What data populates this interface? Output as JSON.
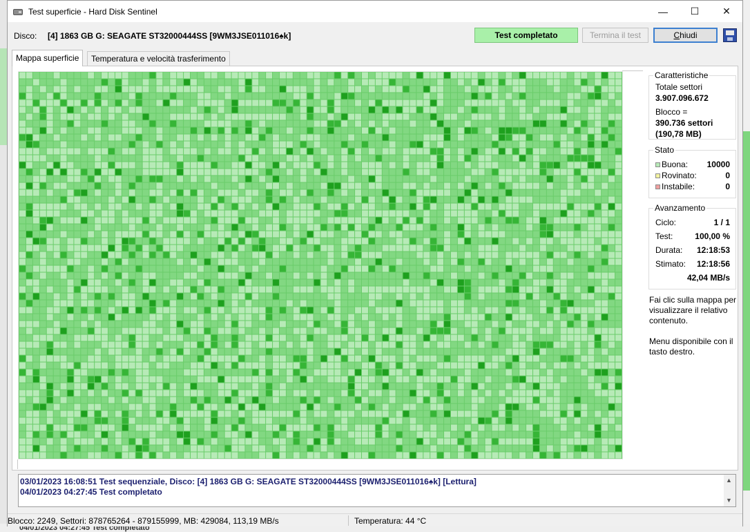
{
  "window": {
    "title": "Test superficie - Hard Disk Sentinel",
    "controls": {
      "minimize": "—",
      "maximize": "☐",
      "close": "✕"
    }
  },
  "header": {
    "disk_label": "Disco:",
    "disk_value": "[4] 1863 GB G: SEAGATE ST32000444SS [9WM3JSE011016♠k]",
    "status_button": "Test completato",
    "stop_button": "Termina il test",
    "close_button_first": "C",
    "close_button_rest": "hiudi"
  },
  "tabs": [
    {
      "label": "Mappa superficie",
      "active": true
    },
    {
      "label": "Temperatura e velocità trasferimento",
      "active": false
    }
  ],
  "surface_map": {
    "cols": 88,
    "rows": 56,
    "block_count": 10000,
    "colors": {
      "grid": "#6acc6a",
      "normal": "#82d882",
      "light": "#b7eab7",
      "dark": "#36b536",
      "deep": "#1ea01e"
    }
  },
  "characteristics": {
    "title": "Caratteristiche",
    "total_label": "Totale settori",
    "total_value": "3.907.096.672",
    "block_label": "Blocco =",
    "block_sectors": "390.736 settori",
    "block_mb": "(190,78 MB)"
  },
  "state": {
    "title": "Stato",
    "rows": [
      {
        "label": "Buona:",
        "value": "10000",
        "color": "#b7eab7"
      },
      {
        "label": "Rovinato:",
        "value": "0",
        "color": "#f3f3a0"
      },
      {
        "label": "Instabile:",
        "value": "0",
        "color": "#f0a0a0"
      }
    ]
  },
  "progress": {
    "title": "Avanzamento",
    "rows": [
      {
        "label": "Ciclo:",
        "value": "1 / 1"
      },
      {
        "label": "Test:",
        "value": "100,00 %"
      },
      {
        "label": "Durata:",
        "value": "12:18:53"
      },
      {
        "label": "Stimato:",
        "value": "12:18:56"
      }
    ],
    "speed": "42,04 MB/s"
  },
  "help": {
    "click_hint": "Fai clic sulla mappa per visualizzare il relativo contenuto.",
    "menu_hint": "Menu disponibile con il tasto destro."
  },
  "log": [
    "03/01/2023  16:08:51  Test sequenziale, Disco: [4] 1863 GB G: SEAGATE ST32000444SS [9WM3JSE011016♠k] [Lettura]",
    "04/01/2023  04:27:45  Test completato"
  ],
  "statusbar": {
    "left": "Blocco: 2249, Settori: 878765264 - 879155999, MB: 429084, 113,19 MB/s",
    "right": "Temperatura: 44  °C"
  },
  "background": {
    "bottom_text": "04/01/2023  04:27:45  Test completato"
  }
}
